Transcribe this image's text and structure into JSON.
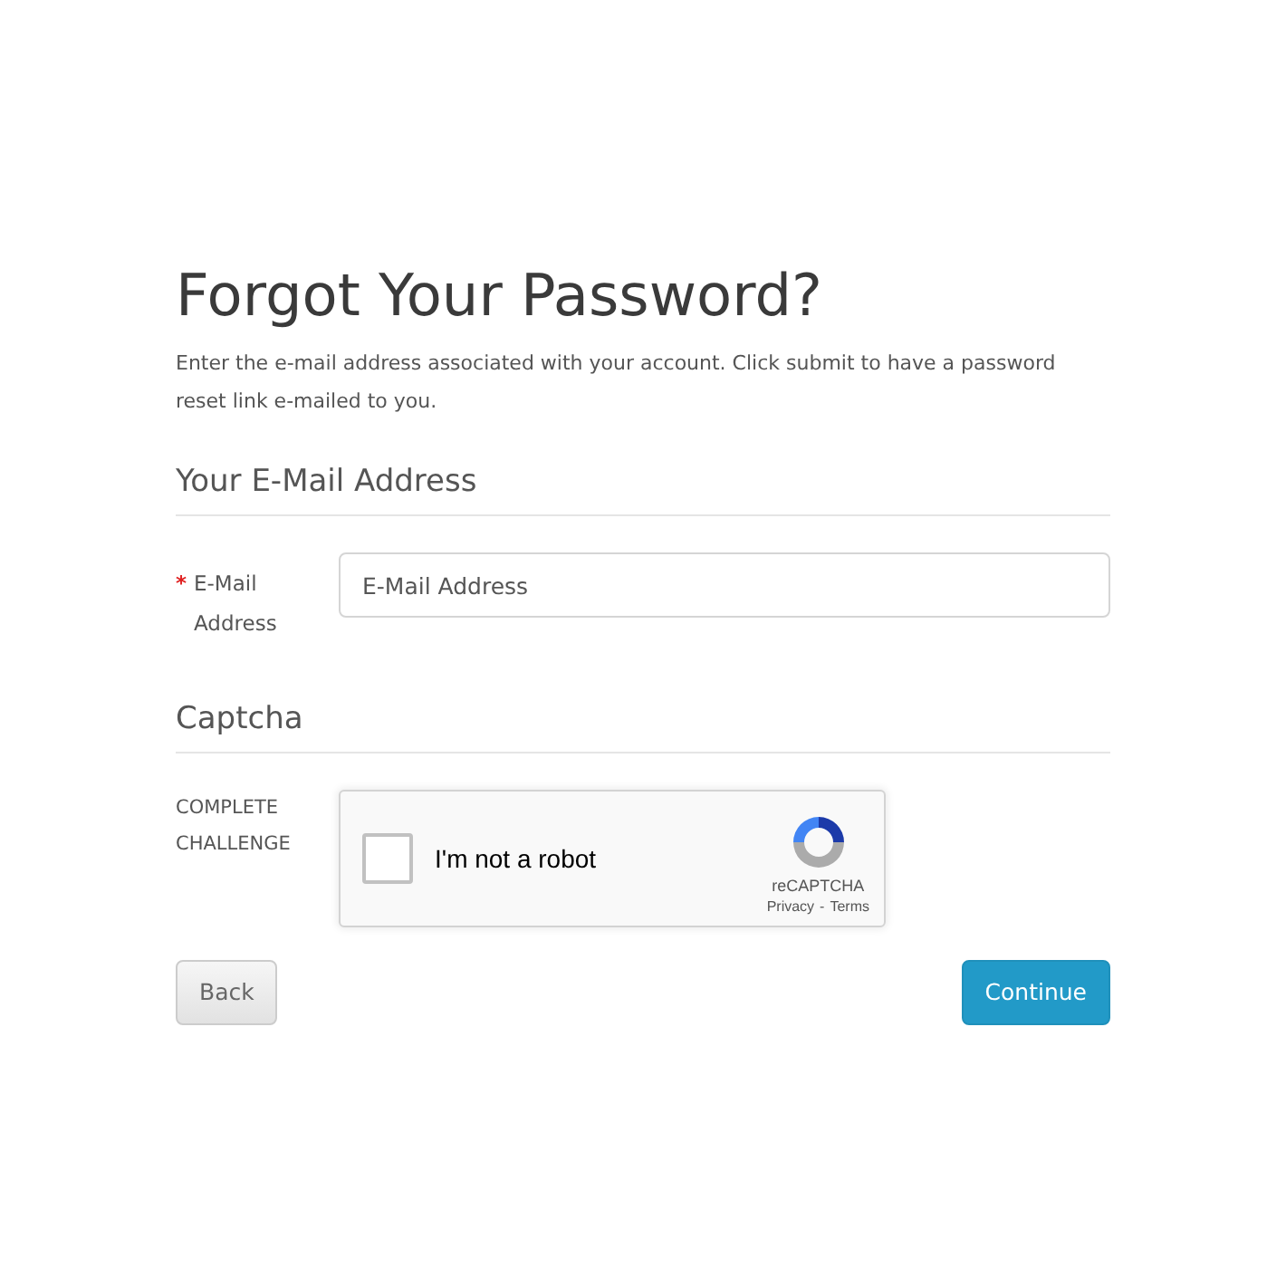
{
  "title": "Forgot Your Password?",
  "intro": "Enter the e-mail address associated with your account. Click submit to have a password reset link e-mailed to you.",
  "sections": [
    {
      "heading": "Your E-Mail Address",
      "kind": "email",
      "label": "E-Mail Address",
      "required": true,
      "required_mark": "*",
      "placeholder": "E-Mail Address"
    },
    {
      "heading": "Captcha",
      "kind": "captcha",
      "label": "COMPLETE CHALLENGE",
      "checkbox_label": "I'm not a robot",
      "checked": false,
      "brand": "reCAPTCHA",
      "privacy": "Privacy",
      "separator": "-",
      "terms": "Terms"
    }
  ],
  "buttons": [
    {
      "label": "Back",
      "kind": "secondary"
    },
    {
      "label": "Continue",
      "kind": "primary"
    }
  ]
}
